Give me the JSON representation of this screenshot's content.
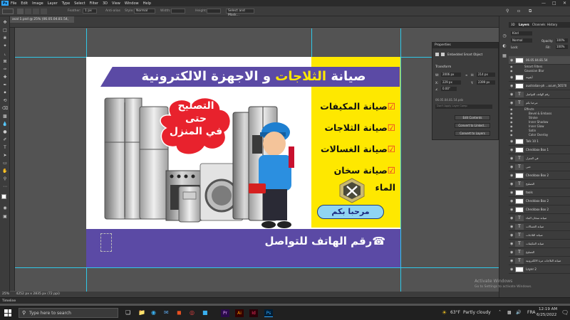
{
  "app": {
    "logo": "Ps",
    "menu": [
      "File",
      "Edit",
      "Image",
      "Layer",
      "Type",
      "Select",
      "Filter",
      "3D",
      "View",
      "Window",
      "Help"
    ]
  },
  "options": {
    "feather_label": "Feather:",
    "feather_value": "1 px",
    "antialias": "Anti-alias",
    "style_label": "Style:",
    "style_value": "Normal",
    "width_label": "Width:",
    "height_label": "Height:",
    "select_mask": "Select and Mask..."
  },
  "doc": {
    "tab_title": "asal 1.psd @ 25% (06.05.04.81.54, CMYK/8)",
    "zoom": "25%",
    "dims": "4252 px x 2835 px (72 ppi)"
  },
  "timeline": {
    "label": "Timeline"
  },
  "flyer": {
    "title_part1": "صيانة ",
    "title_highlight": "الثلاجات",
    "title_part2": " و الاجهزة الالكترونية",
    "cloud_lines": [
      "التصليح",
      "حتى",
      "في المنزل"
    ],
    "services": [
      "صيانة المكيفات",
      "صيانة الثلاجات",
      "صيانة الغسالات",
      "صيانة سخان الماء"
    ],
    "welcome": "مرحبا بكم",
    "phone": "رقم الهاتف للتواصل"
  },
  "properties": {
    "title": "Properties",
    "subtitle": "Embedded Smart Object",
    "transform": "Transform",
    "w_label": "W:",
    "w_value": "2006 px",
    "h_label": "H:",
    "h_value": "214 px",
    "x_label": "X:",
    "x_value": "229 px",
    "y_label": "Y:",
    "y_value": "2399 px",
    "angle": "0.00°",
    "file": "06.05.04.81.54.psb",
    "comps": "Don't Apply Layer Comp",
    "btn_edit": "Edit Contents",
    "btn_linked": "Convert to Linked...",
    "btn_layers": "Convert to Layers"
  },
  "layers_panel": {
    "tabs": [
      "3D",
      "Layers",
      "Channels",
      "History"
    ],
    "kind": "Kind",
    "blend": "Normal",
    "opacity_label": "Opacity:",
    "opacity_value": "100%",
    "lock_label": "Lock:",
    "fill_label": "Fill:",
    "fill_value": "100%",
    "rows": [
      {
        "name": "06.05.04.81.54",
        "type": "smart"
      },
      {
        "name": "Smart Filters",
        "type": "sub"
      },
      {
        "name": "Gaussian Blur",
        "type": "sub"
      },
      {
        "name": "أيقونة",
        "type": "image"
      },
      {
        "name": "australian-ph ...ocum_56570",
        "type": "image"
      },
      {
        "name": "رقم الهاتف للتواصل",
        "type": "text"
      },
      {
        "name": "مرحبا بكم",
        "type": "text"
      },
      {
        "name": "Effects",
        "type": "sub"
      },
      {
        "name": "Bevel & Emboss",
        "type": "effect"
      },
      {
        "name": "Stroke",
        "type": "effect"
      },
      {
        "name": "Inner Shadow",
        "type": "effect"
      },
      {
        "name": "Inner Glow",
        "type": "effect"
      },
      {
        "name": "Satin",
        "type": "effect"
      },
      {
        "name": "Color Overlay",
        "type": "effect"
      },
      {
        "name": "Talk 10 1",
        "type": "image"
      },
      {
        "name": "Checkbox Box 1",
        "type": "image"
      },
      {
        "name": "في المنزل",
        "type": "text"
      },
      {
        "name": "حتى",
        "type": "text"
      },
      {
        "name": "Checkbox Box 2",
        "type": "image"
      },
      {
        "name": "التصليح",
        "type": "text"
      },
      {
        "name": "tools",
        "type": "image"
      },
      {
        "name": "Checkbox Box 2",
        "type": "image"
      },
      {
        "name": "Checkbox Box 2",
        "type": "image"
      },
      {
        "name": "صيانة سخان الماء",
        "type": "text"
      },
      {
        "name": "صيانة الغسالات",
        "type": "text"
      },
      {
        "name": "صيانة الثلاجات",
        "type": "text"
      },
      {
        "name": "صيانة المكيفات",
        "type": "text"
      },
      {
        "name": "التصليح",
        "type": "text"
      },
      {
        "name": "صيانة الثلاجات مرة الالكترونية",
        "type": "text"
      },
      {
        "name": "Layer 2",
        "type": "image"
      }
    ]
  },
  "watermark": {
    "line1": "Activate Windows",
    "line2": "Go to Settings to activate Windows."
  },
  "taskbar": {
    "search_placeholder": "Type here to search",
    "weather_temp": "63°F",
    "weather_text": "Partly cloudy",
    "lang": "FRA",
    "time": "12:19 AM",
    "date": "6/25/2022"
  },
  "colors": {
    "purple": "#5b4aa5",
    "yellow": "#fee800",
    "red": "#e8222d",
    "ps_blue": "#31a8ff"
  }
}
